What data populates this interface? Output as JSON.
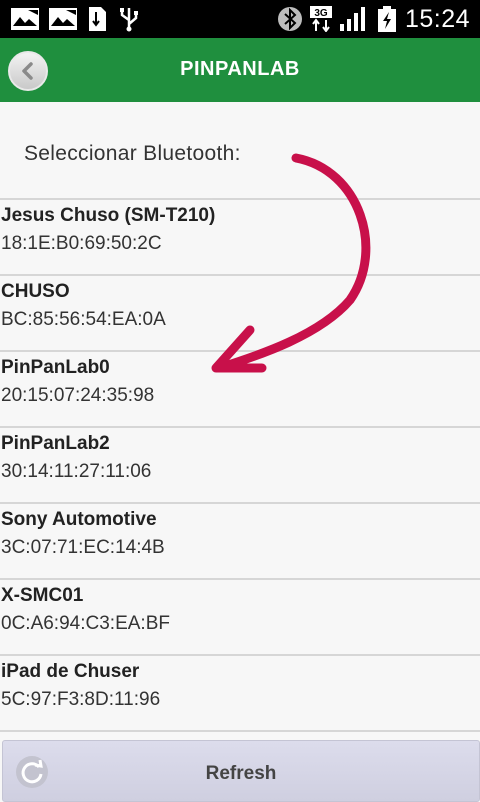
{
  "statusbar": {
    "time": "15:24",
    "network": "3G",
    "icons": [
      "image-icon",
      "image-icon",
      "sd-card-icon",
      "usb-icon",
      "bluetooth-icon",
      "data-3g-icon",
      "signal-icon",
      "battery-charging-icon"
    ]
  },
  "appbar": {
    "title": "PINPANLAB",
    "back_icon": "chevron-left-icon"
  },
  "section_label": "Seleccionar Bluetooth:",
  "devices": [
    {
      "name": "Jesus Chuso (SM-T210)",
      "mac": "18:1E:B0:69:50:2C"
    },
    {
      "name": "CHUSO",
      "mac": "BC:85:56:54:EA:0A"
    },
    {
      "name": "PinPanLab0",
      "mac": "20:15:07:24:35:98"
    },
    {
      "name": "PinPanLab2",
      "mac": "30:14:11:27:11:06"
    },
    {
      "name": "Sony Automotive",
      "mac": "3C:07:71:EC:14:4B"
    },
    {
      "name": "X-SMC01",
      "mac": "0C:A6:94:C3:EA:BF"
    },
    {
      "name": "iPad de Chuser",
      "mac": "5C:97:F3:8D:11:96"
    }
  ],
  "refresh": {
    "label": "Refresh",
    "icon": "refresh-icon"
  },
  "colors": {
    "appbar": "#1f8f3e",
    "arrow": "#c8104a"
  }
}
